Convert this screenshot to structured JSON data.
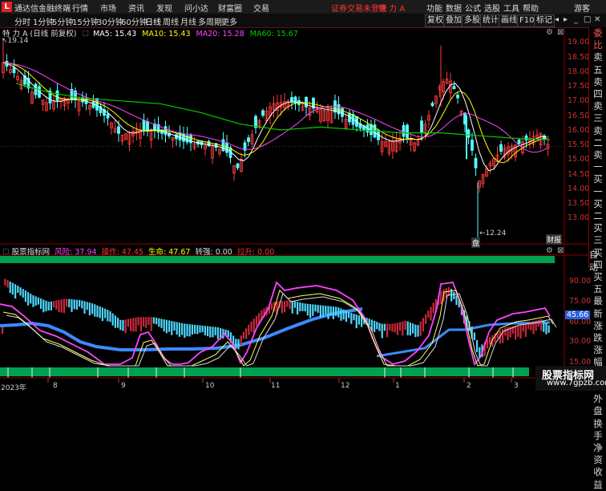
{
  "titlebar": {
    "logo": "L",
    "app_name": "通达信金融终端",
    "menu": [
      "行情",
      "市场",
      "资讯",
      "发现",
      "问小达",
      "财富圈",
      "交易"
    ],
    "login_status": "证券交易未登录",
    "stock": "特 力 A",
    "right_items": [
      "功能",
      "数据",
      "公式",
      "选股",
      "工具",
      "帮助",
      "游客"
    ]
  },
  "toolbar": {
    "periods": [
      "分时",
      "1分钟",
      "5分钟",
      "15分钟",
      "30分钟",
      "60分钟",
      "日线",
      "周线",
      "月线",
      "多周期",
      "更多"
    ],
    "active_period": "日线",
    "right_buttons": [
      "复权",
      "叠加",
      "多股",
      "统计",
      "画线",
      "F10",
      "标记"
    ]
  },
  "kline_info": {
    "title": "特 力 A (日线 前复权)",
    "ma5": "MA5: 15.43",
    "ma10": "MA10: 15.43",
    "ma20": "MA20: 15.28",
    "ma60": "MA60: 15.67",
    "colors": {
      "ma5": "#ffffff",
      "ma10": "#ffff00",
      "ma20": "#ff44ff",
      "ma60": "#00cc00"
    }
  },
  "right_panel": [
    "委比",
    "卖五",
    "卖四",
    "卖三",
    "卖二",
    "卖一",
    "买一",
    "买二",
    "买三",
    "买四",
    "买五",
    "最新",
    "涨跌",
    "涨幅",
    "总量",
    "外盘",
    "换手",
    "净资",
    "收益"
  ],
  "price_axis": [
    "19.00",
    "18.50",
    "18.00",
    "17.50",
    "17.00",
    "16.50",
    "16.00",
    "15.50",
    "15.00",
    "14.50",
    "14.00",
    "13.50",
    "13.00"
  ],
  "price_marks": {
    "high": "19.14",
    "low": "12.24",
    "current": "15.43"
  },
  "chart_tags": {
    "low_tag": "盘",
    "finance_tag": "财报"
  },
  "indicator": {
    "name": "股票指标网",
    "risk": "风险: 37.94",
    "operate": "操作: 47.45",
    "life": "生命: 47.67",
    "turn": "转强: 0.00",
    "pull": "拉升: 0.00",
    "axis": [
      "90.00",
      "75.00",
      "60.00",
      "45.00",
      "30.00",
      "15.00"
    ],
    "current_value": "45.66",
    "auto_label": "自动"
  },
  "date_axis": [
    "2023年",
    "8",
    "9",
    "10",
    "11",
    "12",
    "1",
    "2",
    "3"
  ],
  "watermark": {
    "line1": "股票指标网",
    "line2": "www.7gpzb.com"
  }
}
